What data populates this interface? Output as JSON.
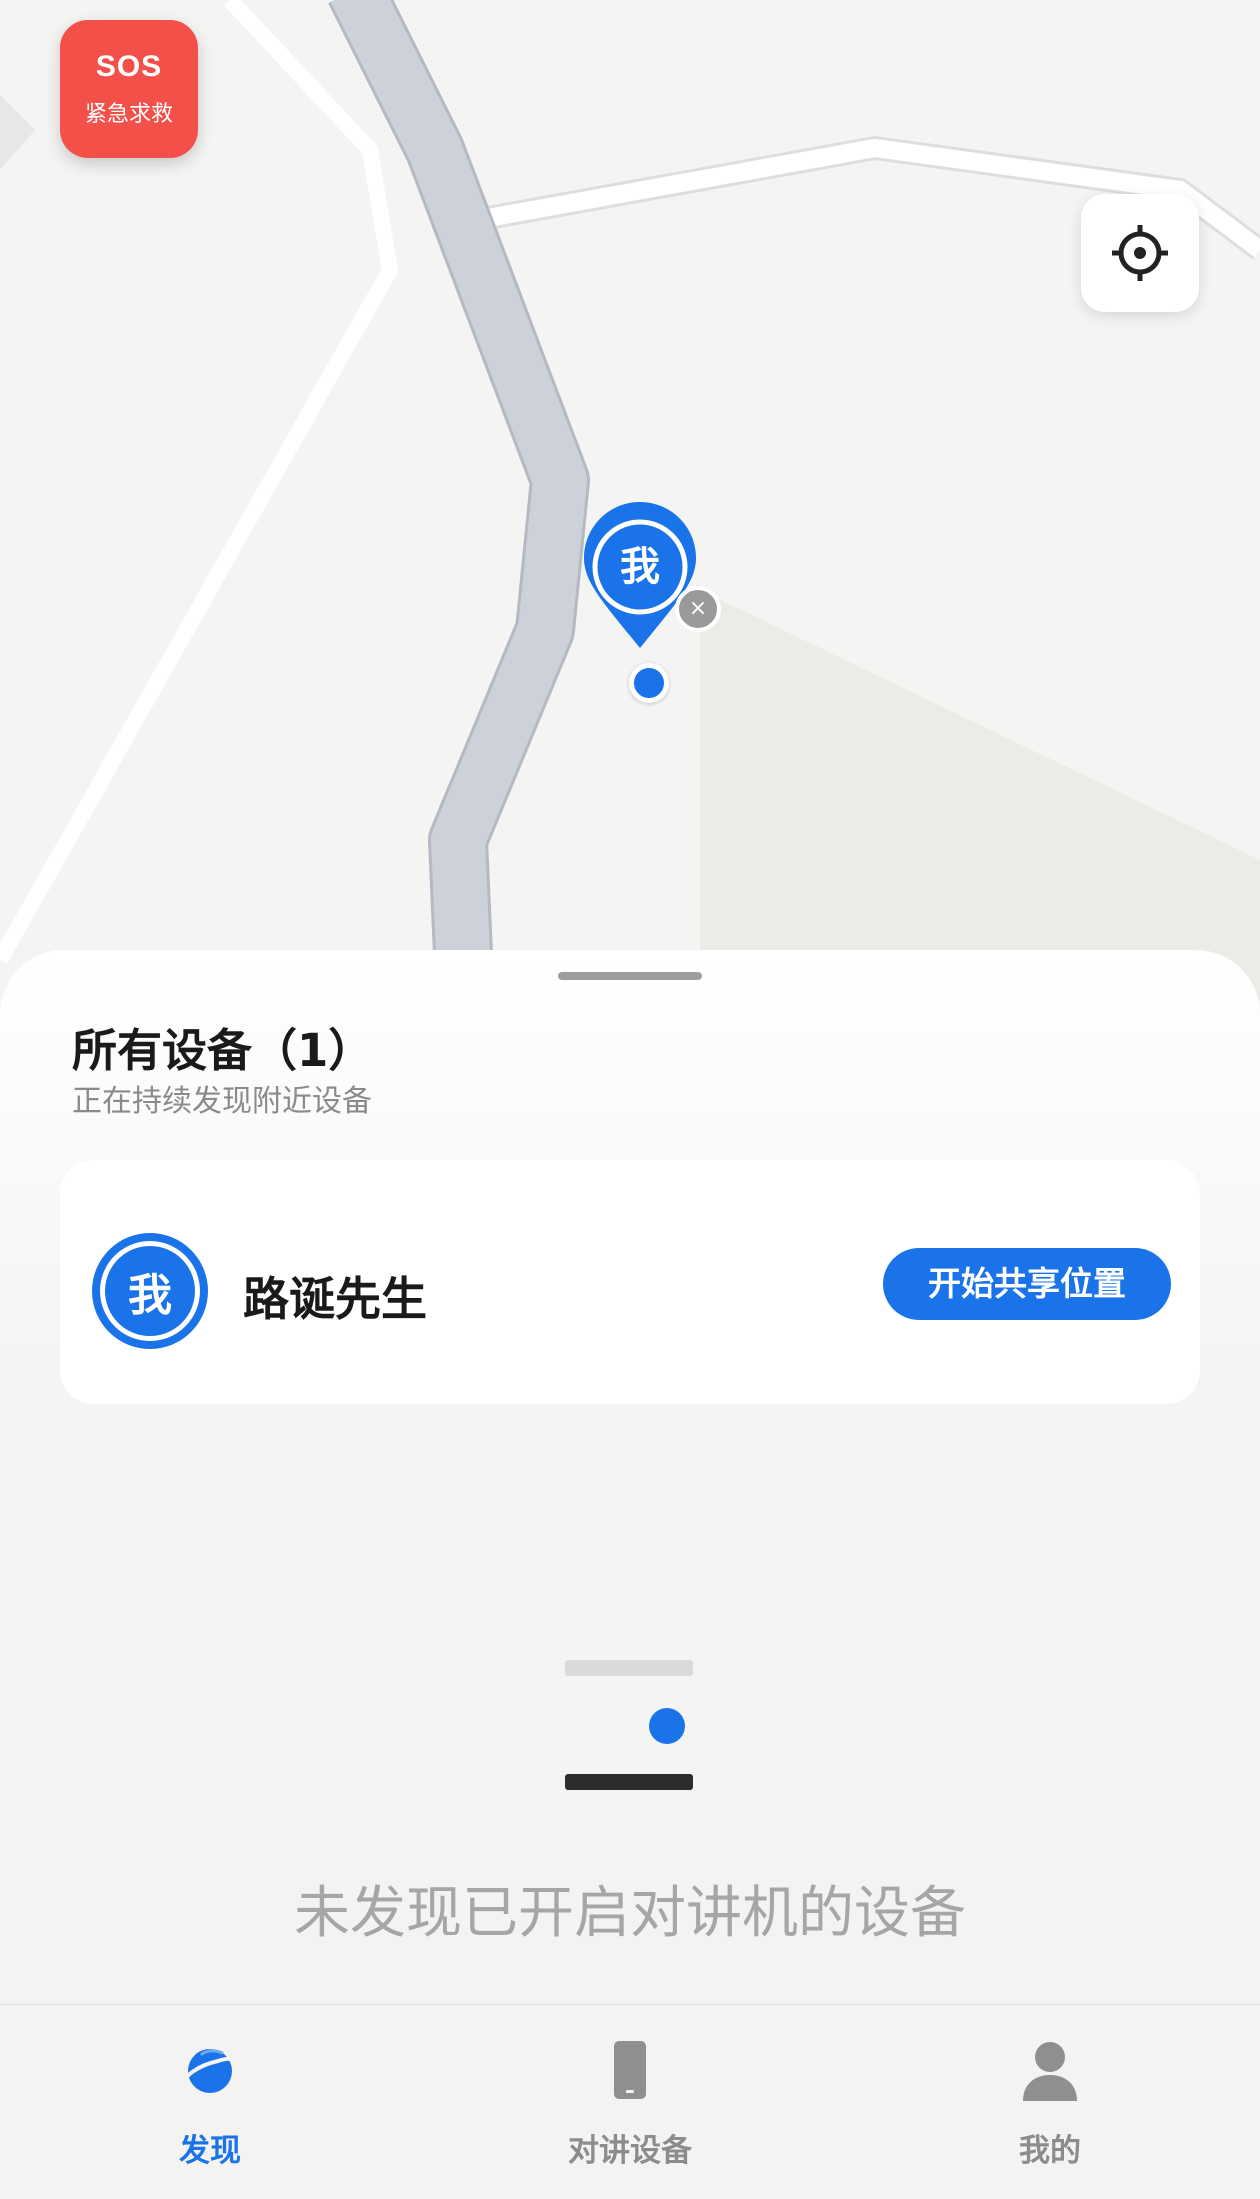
{
  "sos": {
    "title": "SOS",
    "subtitle": "紧急求救"
  },
  "map": {
    "me_marker_label": "我",
    "pin_close_glyph": "×",
    "icons": [
      "crosshair-icon",
      "location-pin-icon",
      "close-icon",
      "location-dot"
    ]
  },
  "sheet": {
    "title": "所有设备（1）",
    "subtitle": "正在持续发现附近设备",
    "devices": [
      {
        "avatar_label": "我",
        "name": "路诞先生",
        "action_label": "开始共享位置"
      }
    ],
    "empty_text": "未发现已开启对讲机的设备"
  },
  "tabs": [
    {
      "label": "发现",
      "icon": "planet-icon",
      "active": true
    },
    {
      "label": "对讲设备",
      "icon": "phone-icon",
      "active": false
    },
    {
      "label": "我的",
      "icon": "person-icon",
      "active": false
    }
  ],
  "colors": {
    "accent": "#1a73e8",
    "sos": "#f4504a",
    "road": "#cdd1d9",
    "muted_text": "#a6a6a6"
  }
}
